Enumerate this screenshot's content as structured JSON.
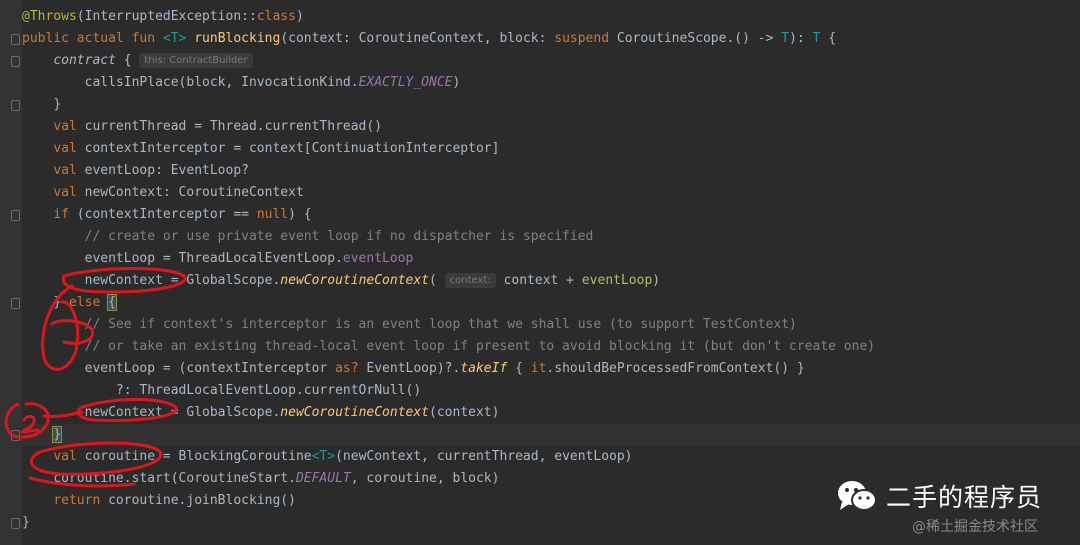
{
  "code": {
    "annotation": "@Throws",
    "annotation_arg": "(InterruptedException::",
    "kw_class": "class",
    "paren_close": ")",
    "kw_public": "public",
    "kw_actual": "actual",
    "kw_fun": "fun",
    "tparam": "<T>",
    "fn_name": "runBlocking",
    "params_1": "(context: CoroutineContext, block: ",
    "kw_suspend": "suspend",
    "params_2": " CoroutineScope.() -> ",
    "type_T": "T",
    "params_3": "): ",
    "brace_open": "{",
    "contract_call": "contract",
    "hint_this": "this: ContractBuilder",
    "calls_in_place": "callsInPlace(block, InvocationKind.",
    "exactly_once": "EXACTLY_ONCE",
    "brace_close": "}",
    "kw_val": "val",
    "current_thread": "currentThread = Thread.currentThread()",
    "context_interceptor": "contextInterceptor = context[ContinuationInterceptor]",
    "event_loop_decl": "eventLoop: EventLoop?",
    "new_context_decl": "newContext: CoroutineContext",
    "kw_if": "if",
    "if_cond_1": "(contextInterceptor == ",
    "kw_null": "null",
    "if_cond_2": ") {",
    "comment_1": "// create or use private event loop if no dispatcher is specified",
    "event_loop_assign": "eventLoop = ThreadLocalEventLoop.",
    "event_loop_prop": "eventLoop",
    "new_context_assign": "newContext = GlobalScope.",
    "new_coroutine_context": "newCoroutineContext",
    "paren_open": "(",
    "hint_context": "context:",
    "context_plus": "context + ",
    "event_loop_var": "eventLoop",
    "else_open": "} ",
    "kw_else": "else",
    "comment_2": "// See if context's interceptor is an event loop that we shall use (to support TestContext)",
    "comment_3": "// or take an existing thread-local event loop if present to avoid blocking it (but don't create one)",
    "event_loop_cast_1": "eventLoop = (contextInterceptor ",
    "kw_as": "as?",
    "event_loop_cast_2": " EventLoop)?.",
    "take_if": "takeIf",
    "take_if_open": " { ",
    "kw_it": "it",
    "should_be_processed": ".shouldBeProcessedFromContext() }",
    "current_or_null": "?: ThreadLocalEventLoop.currentOrNull()",
    "new_context_assign_2_end": "(context)",
    "coroutine_decl_1": "coroutine = BlockingCoroutine",
    "coroutine_decl_2": "(newContext, currentThread, eventLoop)",
    "coroutine_start_1": "coroutine.start(CoroutineStart.",
    "default_const": "DEFAULT",
    "coroutine_start_2": ", coroutine, block)",
    "kw_return": "return",
    "return_expr": " coroutine.joinBlocking()"
  },
  "watermark": {
    "icon": "wechat-icon",
    "title": "二手的程序员",
    "source": "@稀土掘金技术社区"
  },
  "colors": {
    "background": "#2b2b2b",
    "keyword": "#cc7832",
    "function": "#ffc66d",
    "comment": "#808080",
    "ink": "#e0141b"
  }
}
